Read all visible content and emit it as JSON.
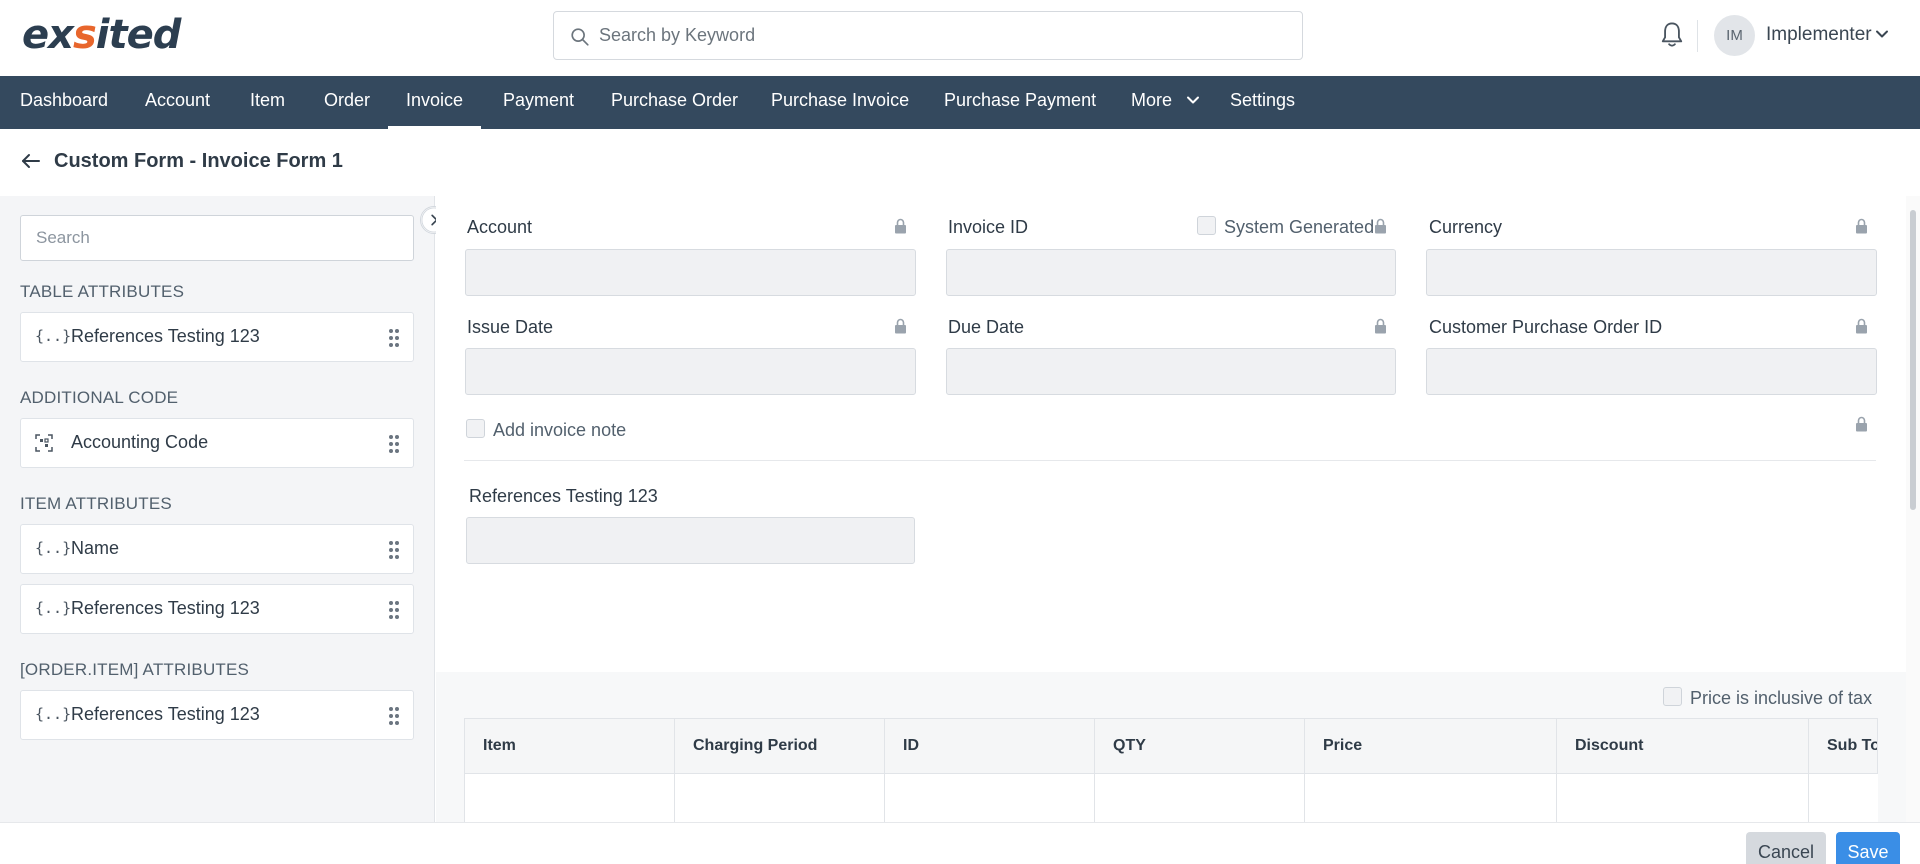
{
  "header": {
    "logo_text_left": "ex",
    "logo_text_accent": "s",
    "logo_text_right": "ited",
    "search_placeholder": "Search by Keyword",
    "user_initials": "IM",
    "user_name": "Implementer"
  },
  "nav": {
    "items": [
      {
        "label": "Dashboard",
        "active": false
      },
      {
        "label": "Account",
        "active": false
      },
      {
        "label": "Item",
        "active": false
      },
      {
        "label": "Order",
        "active": false
      },
      {
        "label": "Invoice",
        "active": true
      },
      {
        "label": "Payment",
        "active": false
      },
      {
        "label": "Purchase Order",
        "active": false
      },
      {
        "label": "Purchase Invoice",
        "active": false
      },
      {
        "label": "Purchase Payment",
        "active": false
      },
      {
        "label": "More",
        "active": false
      },
      {
        "label": "Settings",
        "active": false
      }
    ]
  },
  "page": {
    "title": "Custom Form - Invoice Form 1"
  },
  "sidebar": {
    "search_placeholder": "Search",
    "groups": [
      {
        "heading": "TABLE ATTRIBUTES",
        "items": [
          {
            "icon": "{..}",
            "label": "References Testing 123"
          }
        ]
      },
      {
        "heading": "ADDITIONAL CODE",
        "items": [
          {
            "icon": "code-scan-icon",
            "label": "Accounting Code"
          }
        ]
      },
      {
        "heading": "ITEM ATTRIBUTES",
        "items": [
          {
            "icon": "{..}",
            "label": "Name"
          },
          {
            "icon": "{..}",
            "label": "References Testing 123"
          }
        ]
      },
      {
        "heading": "[ORDER.ITEM] ATTRIBUTES",
        "items": [
          {
            "icon": "{..}",
            "label": "References Testing 123"
          }
        ]
      }
    ]
  },
  "form": {
    "account_label": "Account",
    "invoice_id_label": "Invoice ID",
    "system_generated_label": "System Generated",
    "currency_label": "Currency",
    "issue_date_label": "Issue Date",
    "due_date_label": "Due Date",
    "customer_po_label": "Customer Purchase Order ID",
    "add_note_label": "Add invoice note",
    "references_label": "References Testing 123",
    "price_inclusive_label": "Price is inclusive of tax"
  },
  "table": {
    "columns": [
      "Item",
      "Charging Period",
      "ID",
      "QTY",
      "Price",
      "Discount",
      "Sub Total"
    ]
  },
  "footer": {
    "cancel_label": "Cancel",
    "save_label": "Save"
  },
  "colors": {
    "nav_bg": "#34495e",
    "accent": "#e8662c",
    "primary_button": "#3a8ee6"
  }
}
